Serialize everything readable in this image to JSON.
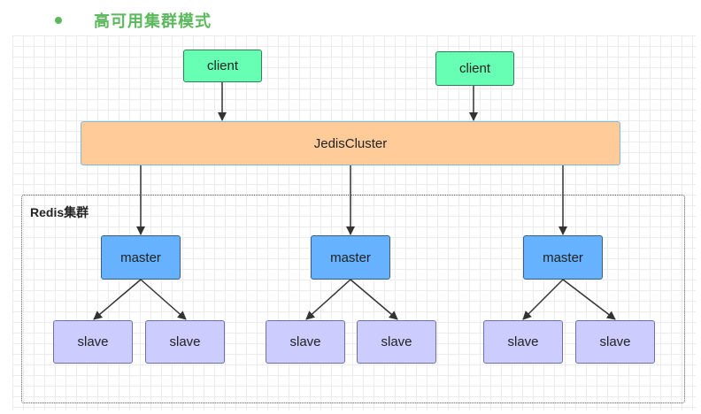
{
  "heading": "高可用集群模式",
  "clients": [
    "client",
    "client"
  ],
  "router": "JedisCluster",
  "cluster": {
    "label": "Redis集群",
    "groups": [
      {
        "master": "master",
        "slaves": [
          "slave",
          "slave"
        ]
      },
      {
        "master": "master",
        "slaves": [
          "slave",
          "slave"
        ]
      },
      {
        "master": "master",
        "slaves": [
          "slave",
          "slave"
        ]
      }
    ]
  },
  "colors": {
    "heading": "#5cb85c",
    "client": "#66ffb3",
    "router": "#ffcc99",
    "master": "#66b2ff",
    "slave": "#ccccff",
    "arrow": "#333333"
  }
}
